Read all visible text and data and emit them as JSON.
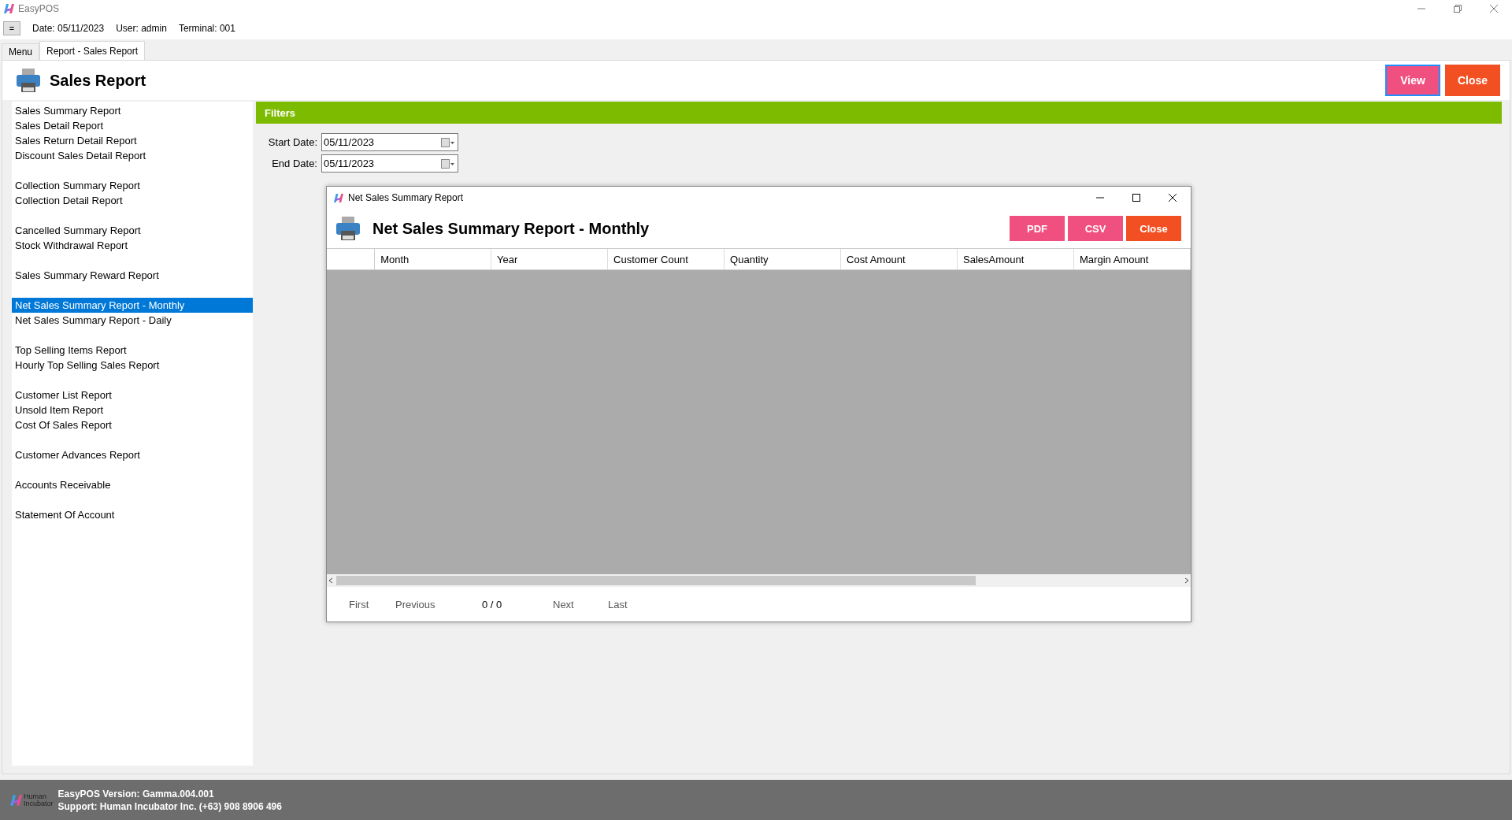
{
  "window": {
    "title": "EasyPOS"
  },
  "info_bar": {
    "menu_button": "=",
    "date": "Date: 05/11/2023",
    "user": "User: admin",
    "terminal": "Terminal: 001"
  },
  "tabs": [
    {
      "label": "Menu",
      "selected": false
    },
    {
      "label": "Report - Sales Report",
      "selected": true
    }
  ],
  "page": {
    "title": "Sales Report",
    "buttons": [
      {
        "label": "View",
        "color": "#f05080",
        "focused": true
      },
      {
        "label": "Close",
        "color": "#f25022",
        "focused": false
      }
    ]
  },
  "sidebar": {
    "groups": [
      {
        "items": [
          {
            "label": "Sales Summary Report",
            "selected": false
          },
          {
            "label": "Sales Detail Report",
            "selected": false
          },
          {
            "label": "Sales Return Detail Report",
            "selected": false
          },
          {
            "label": "Discount Sales Detail Report",
            "selected": false
          }
        ]
      },
      {
        "items": [
          {
            "label": "Collection Summary Report",
            "selected": false
          },
          {
            "label": "Collection Detail Report",
            "selected": false
          }
        ]
      },
      {
        "items": [
          {
            "label": "Cancelled Summary Report",
            "selected": false
          },
          {
            "label": "Stock Withdrawal Report",
            "selected": false
          }
        ]
      },
      {
        "items": [
          {
            "label": "Sales Summary Reward Report",
            "selected": false
          }
        ]
      },
      {
        "items": [
          {
            "label": "Net Sales Summary Report - Monthly",
            "selected": true
          },
          {
            "label": "Net Sales Summary Report - Daily",
            "selected": false
          }
        ]
      },
      {
        "items": [
          {
            "label": "Top Selling Items Report",
            "selected": false
          },
          {
            "label": "Hourly Top Selling Sales Report",
            "selected": false
          }
        ]
      },
      {
        "items": [
          {
            "label": "Customer List Report",
            "selected": false
          },
          {
            "label": "Unsold Item Report",
            "selected": false
          },
          {
            "label": "Cost Of Sales Report",
            "selected": false
          }
        ]
      },
      {
        "items": [
          {
            "label": "Customer Advances Report",
            "selected": false
          }
        ]
      },
      {
        "items": [
          {
            "label": "Accounts Receivable",
            "selected": false
          }
        ]
      },
      {
        "items": [
          {
            "label": "Statement Of Account",
            "selected": false
          }
        ]
      }
    ]
  },
  "filters": {
    "title": "Filters",
    "fields": [
      {
        "label": "Start Date:",
        "value": "05/11/2023"
      },
      {
        "label": "End Date:",
        "value": "05/11/2023"
      }
    ]
  },
  "dialog": {
    "title": "Net Sales Summary Report",
    "heading": "Net Sales Summary Report - Monthly",
    "buttons": [
      {
        "label": "PDF",
        "color": "#f05080"
      },
      {
        "label": "CSV",
        "color": "#f05080"
      },
      {
        "label": "Close",
        "color": "#f25022"
      }
    ],
    "table": {
      "columns": [
        "Month",
        "Year",
        "Customer Count",
        "Quantity",
        "Cost Amount",
        "SalesAmount",
        "Margin Amount"
      ]
    },
    "pager": {
      "first": "First",
      "previous": "Previous",
      "position": "0 / 0",
      "next": "Next",
      "last": "Last"
    }
  },
  "status_bar": {
    "logo_text": [
      "Human",
      "Incubator"
    ],
    "version": "EasyPOS Version: Gamma.004.001",
    "support": "Support: Human Incubator Inc. (+63) 908 8906 496"
  }
}
